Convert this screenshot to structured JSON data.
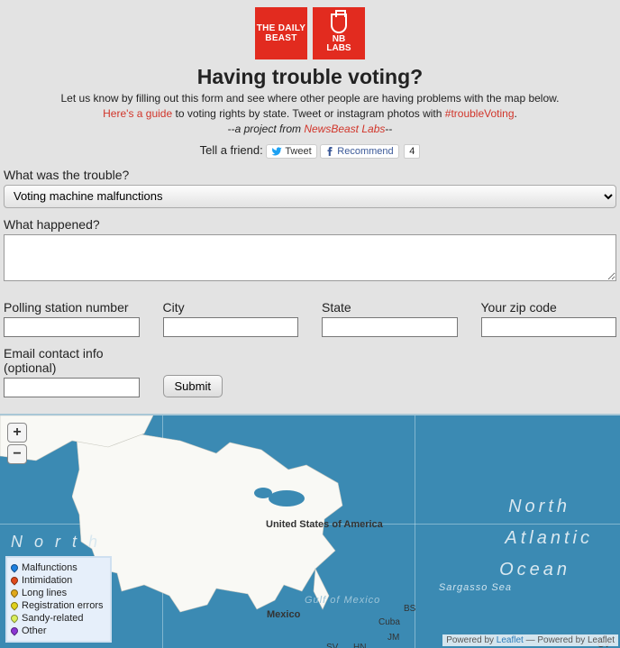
{
  "logos": {
    "db": "THE DAILY\nBEAST",
    "nb": "NB\nLABS"
  },
  "title": "Having trouble voting?",
  "sub1_a": "Let us know by filling out this form and see where other people are having problems with the map below.",
  "sub2_link1": "Here's a guide",
  "sub2_mid": " to voting rights by state. Tweet or instagram photos with ",
  "sub2_hash": "#troubleVoting",
  "sub2_tail": ".",
  "sub3_pre": "--",
  "sub3_em": "a project from ",
  "sub3_link": "NewsBeast Labs",
  "sub3_post": "--",
  "share": {
    "label": "Tell a friend:",
    "tweet": "Tweet",
    "recommend": "Recommend",
    "rec_count": "4"
  },
  "form": {
    "q1_label": "What was the trouble?",
    "q1_selected": "Voting machine malfunctions",
    "q2_label": "What happened?",
    "polling_label": "Polling station number",
    "city_label": "City",
    "state_label": "State",
    "zip_label": "Your zip code",
    "email_label": "Email contact info (optional)",
    "submit": "Submit"
  },
  "map": {
    "water1": "N o r t h",
    "water2": "North",
    "water3": "Atlantic",
    "water4": "Ocean",
    "sargasso": "Sargasso Sea",
    "gulf": "Gulf of Mexico",
    "usa": "United States of America",
    "mexico": "Mexico",
    "cuba": "Cuba",
    "bs": "BS",
    "jm": "JM",
    "hn": "HN",
    "sv": "SV",
    "cv": "CV",
    "zoom_in": "+",
    "zoom_out": "−",
    "attribution_a": "Powered by ",
    "attribution_link": "Leaflet",
    "attribution_b": " — Powered by Leaflet"
  },
  "legend": [
    {
      "color": "#1b7fe0",
      "label": "Malfunctions"
    },
    {
      "color": "#e04a1b",
      "label": "Intimidation"
    },
    {
      "color": "#e0a81b",
      "label": "Long lines"
    },
    {
      "color": "#e0d11b",
      "label": "Registration errors"
    },
    {
      "color": "#d9ef5a",
      "label": "Sandy-related"
    },
    {
      "color": "#8b36d4",
      "label": "Other"
    }
  ]
}
